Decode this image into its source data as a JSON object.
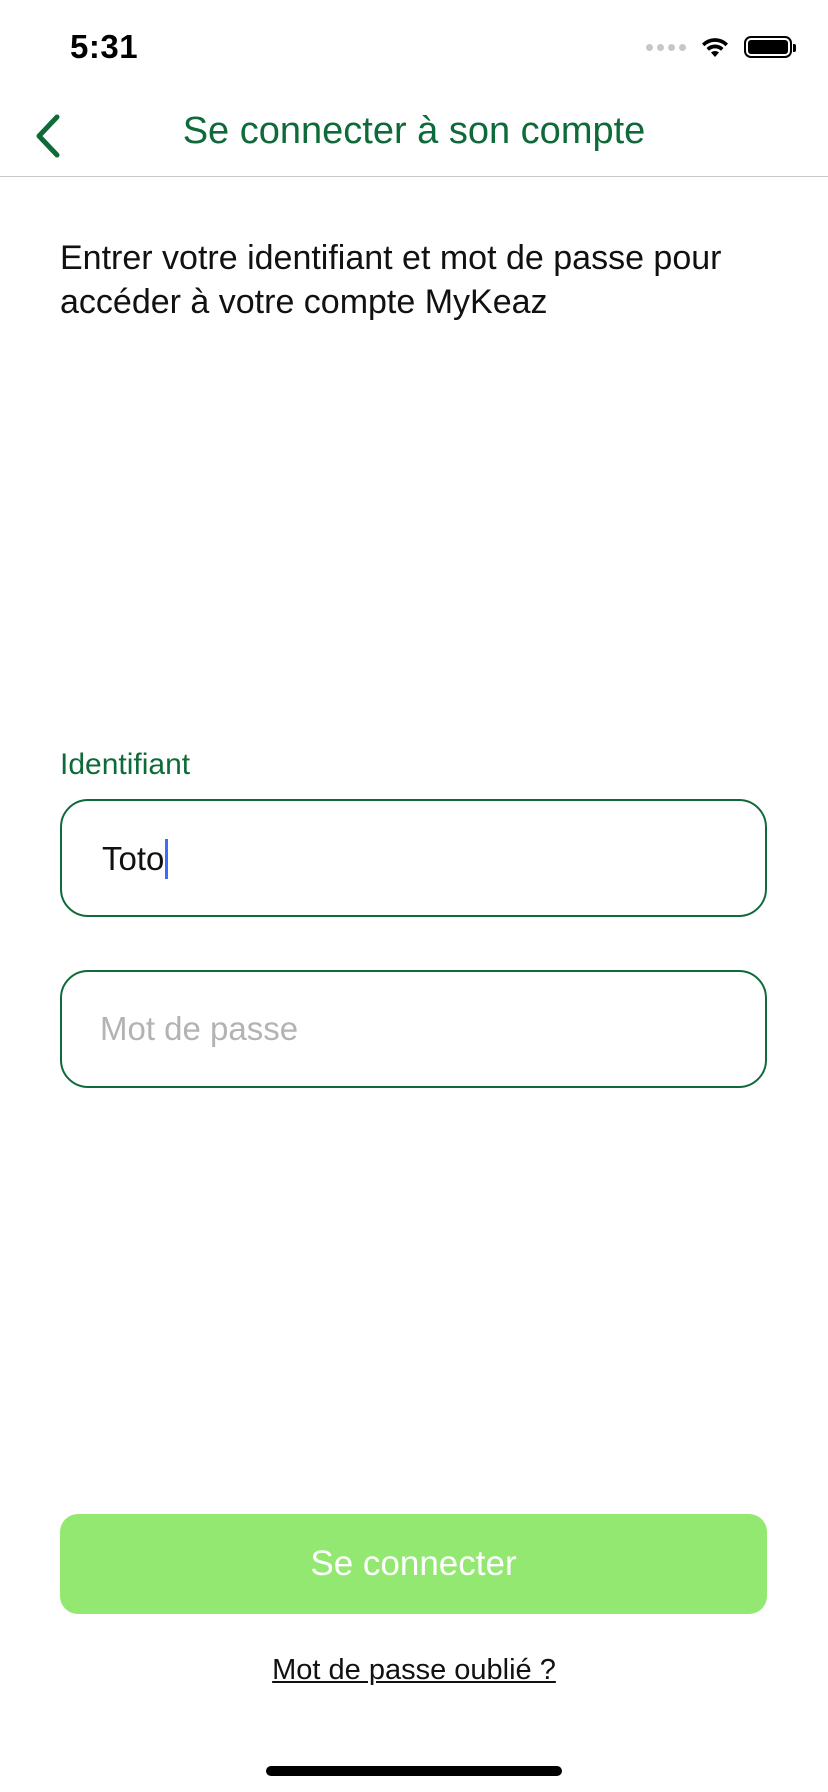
{
  "status_bar": {
    "time": "5:31"
  },
  "nav": {
    "title": "Se connecter à son compte",
    "back_icon": "chevron-left-icon"
  },
  "intro": {
    "text": "Entrer votre identifiant et mot de passe pour accéder à votre compte MyKeaz"
  },
  "username": {
    "label": "Identifiant",
    "value": "Toto"
  },
  "password": {
    "placeholder": "Mot de passe",
    "value": ""
  },
  "actions": {
    "login_label": "Se connecter",
    "forgot_label": "Mot de passe oublié ?"
  },
  "colors": {
    "accent": "#0e6b39",
    "button": "#92e870",
    "caret": "#3d6bff"
  }
}
